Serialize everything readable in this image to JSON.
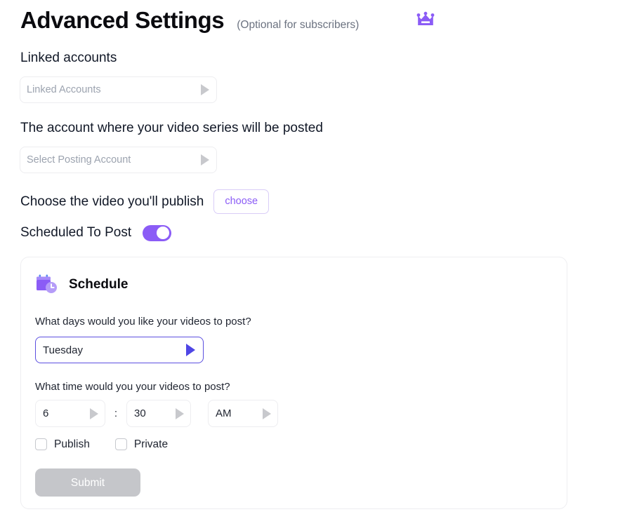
{
  "header": {
    "title": "Advanced Settings",
    "optional_note": "(Optional for subscribers)",
    "crown_icon": "crown-icon",
    "crown_color": "#8b5cf6"
  },
  "linked_accounts": {
    "label": "Linked accounts",
    "select_placeholder": "Linked Accounts",
    "caret_icon": "triangle-right-icon"
  },
  "posting_account": {
    "label": "The account where your video series will be posted",
    "select_placeholder": "Select Posting Account",
    "caret_icon": "triangle-right-icon"
  },
  "choose_video": {
    "label": "Choose the video you'll publish",
    "button_label": "choose",
    "button_color": "#8b5cf6"
  },
  "scheduled_to_post": {
    "label": "Scheduled To Post",
    "toggle_state": "on",
    "toggle_color": "#8b5cf6"
  },
  "schedule_card": {
    "icon": "calendar-clock-icon",
    "title": "Schedule",
    "days_question": "What days would you like your videos to post?",
    "days_value": "Tuesday",
    "days_caret_icon": "triangle-right-icon",
    "days_border_color": "#5b4fe0",
    "time_question": "What time would you your videos to post?",
    "time_hour": "6",
    "time_separator": ":",
    "time_minute": "30",
    "time_meridiem": "AM",
    "checkboxes": [
      {
        "label": "Publish",
        "checked": false
      },
      {
        "label": "Private",
        "checked": false
      }
    ],
    "submit_label": "Submit",
    "submit_enabled": false,
    "submit_color": "#c5c6ca"
  }
}
